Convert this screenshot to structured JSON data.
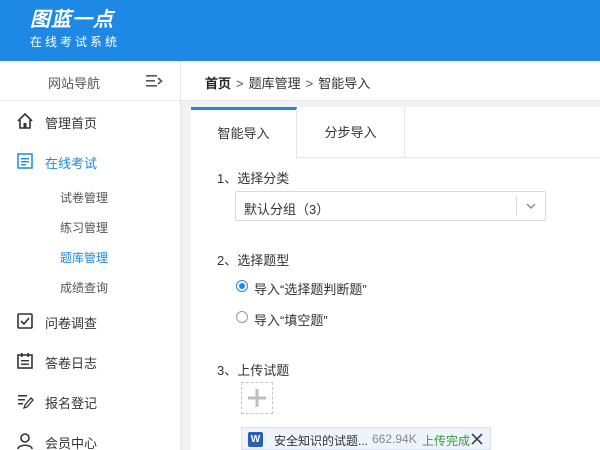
{
  "app": {
    "title": "图蓝一点",
    "subtitle": "在线考试系统"
  },
  "sidebar": {
    "header_label": "网站导航",
    "toggle_icon": "menu-collapse-icon",
    "items": [
      {
        "label": "管理首页",
        "icon": "home-icon"
      },
      {
        "label": "在线考试",
        "icon": "exam-icon",
        "active": true
      },
      {
        "label": "问卷调查",
        "icon": "checkbox-icon"
      },
      {
        "label": "答卷日志",
        "icon": "log-icon"
      },
      {
        "label": "报名登记",
        "icon": "register-icon"
      },
      {
        "label": "会员中心",
        "icon": "user-icon"
      }
    ],
    "sub_items": [
      {
        "label": "试卷管理"
      },
      {
        "label": "练习管理"
      },
      {
        "label": "题库管理",
        "active": true
      },
      {
        "label": "成绩查询"
      }
    ]
  },
  "breadcrumb": {
    "home": "首页",
    "separator": ">",
    "level1": "题库管理",
    "level2": "智能导入"
  },
  "tabs": [
    {
      "label": "智能导入",
      "active": true
    },
    {
      "label": "分步导入"
    }
  ],
  "steps": {
    "step1": {
      "title": "1、选择分类",
      "selected": "默认分组（3）"
    },
    "step2": {
      "title": "2、选择题型",
      "options": [
        {
          "label": "导入“选择题判断题”",
          "checked": true
        },
        {
          "label": "导入“填空题”",
          "checked": false
        }
      ]
    },
    "step3": {
      "title": "3、上传试题",
      "file": {
        "icon_letter": "W",
        "name": "安全知识的试题...",
        "size": "662.94K",
        "status": "上传完成"
      }
    }
  },
  "colors": {
    "accent": "#1e88e5",
    "success": "#3a9a3a"
  }
}
